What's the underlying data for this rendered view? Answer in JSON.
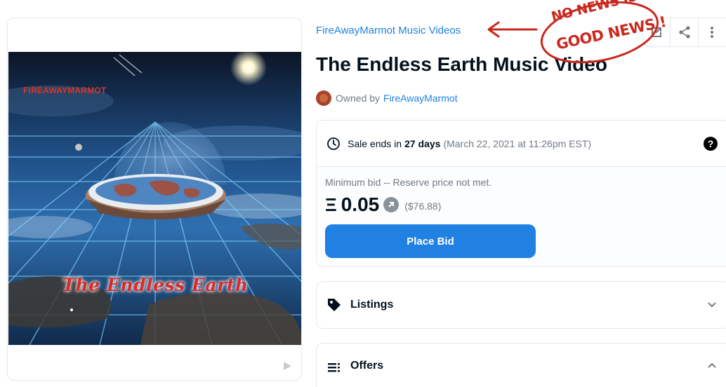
{
  "collection": {
    "name": "FireAwayMarmot Music Videos"
  },
  "item": {
    "title": "The Endless Earth Music Video",
    "owned_by_label": "Owned by",
    "owner_name": "FireAwayMarmot"
  },
  "artwork": {
    "brand_text": "FIREAWAYMARMOT",
    "title_text": "The Endless Earth",
    "media_icon": "play-icon"
  },
  "actions": [
    {
      "icon": "external-link-icon"
    },
    {
      "icon": "share-icon"
    },
    {
      "icon": "more-vertical-icon"
    }
  ],
  "sale": {
    "ends_prefix": "Sale ends in",
    "ends_value": "27 days",
    "ends_date": "(March 22, 2021 at 11:26pm EST)",
    "min_bid_label": "Minimum bid -- Reserve price not met.",
    "currency_symbol": "Ξ",
    "price": "0.05",
    "usd_price": "($76.88)",
    "bid_button": "Place Bid"
  },
  "panels": {
    "listings": "Listings",
    "offers": "Offers"
  },
  "annotation": {
    "line1": "NO NEWS IS",
    "line2": "GOOD NEWS !"
  },
  "colors": {
    "accent": "#2081e2",
    "text": "#04111d",
    "muted": "#707a83",
    "annotation": "#c8291e"
  }
}
